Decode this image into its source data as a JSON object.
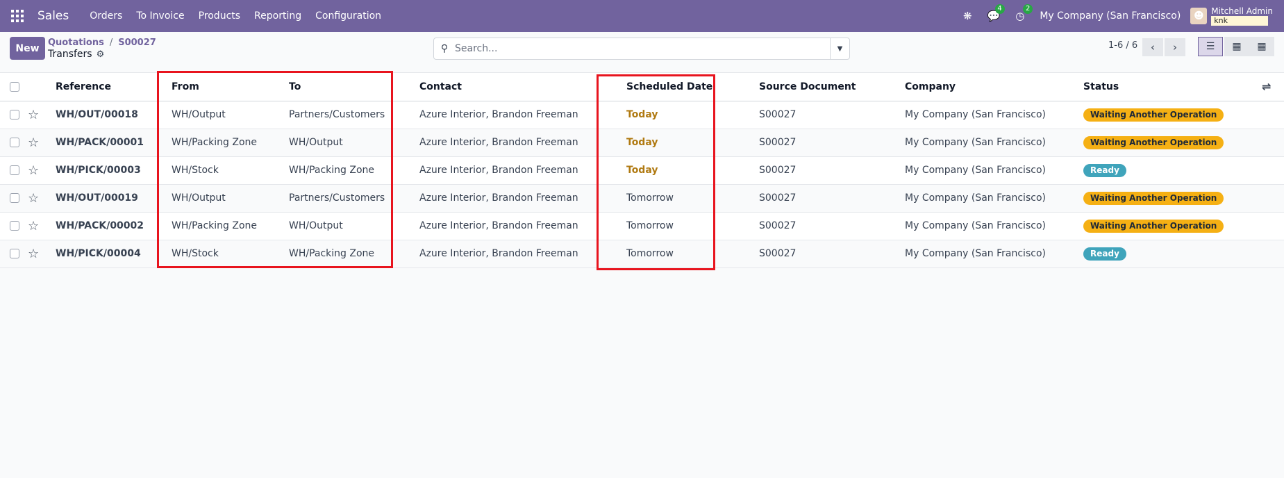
{
  "navbar": {
    "app_name": "Sales",
    "menu": [
      "Orders",
      "To Invoice",
      "Products",
      "Reporting",
      "Configuration"
    ],
    "messages_count": "4",
    "activities_count": "2",
    "company": "My Company (San Francisco)",
    "user_name": "Mitchell Admin",
    "database": "knk"
  },
  "control": {
    "new_label": "New",
    "breadcrumb": [
      "Quotations",
      "S00027"
    ],
    "title": "Transfers",
    "search_placeholder": "Search...",
    "pager": "1-6 / 6"
  },
  "table": {
    "headers": [
      "Reference",
      "From",
      "To",
      "Contact",
      "Scheduled Date",
      "Source Document",
      "Company",
      "Status"
    ],
    "rows": [
      {
        "reference": "WH/OUT/00018",
        "from": "WH/Output",
        "to": "Partners/Customers",
        "contact": "Azure Interior, Brandon Freeman",
        "date": "Today",
        "source": "S00027",
        "company": "My Company (San Francisco)",
        "status": "Waiting Another Operation"
      },
      {
        "reference": "WH/PACK/00001",
        "from": "WH/Packing Zone",
        "to": "WH/Output",
        "contact": "Azure Interior, Brandon Freeman",
        "date": "Today",
        "source": "S00027",
        "company": "My Company (San Francisco)",
        "status": "Waiting Another Operation"
      },
      {
        "reference": "WH/PICK/00003",
        "from": "WH/Stock",
        "to": "WH/Packing Zone",
        "contact": "Azure Interior, Brandon Freeman",
        "date": "Today",
        "source": "S00027",
        "company": "My Company (San Francisco)",
        "status": "Ready"
      },
      {
        "reference": "WH/OUT/00019",
        "from": "WH/Output",
        "to": "Partners/Customers",
        "contact": "Azure Interior, Brandon Freeman",
        "date": "Tomorrow",
        "source": "S00027",
        "company": "My Company (San Francisco)",
        "status": "Waiting Another Operation"
      },
      {
        "reference": "WH/PACK/00002",
        "from": "WH/Packing Zone",
        "to": "WH/Output",
        "contact": "Azure Interior, Brandon Freeman",
        "date": "Tomorrow",
        "source": "S00027",
        "company": "My Company (San Francisco)",
        "status": "Waiting Another Operation"
      },
      {
        "reference": "WH/PICK/00004",
        "from": "WH/Stock",
        "to": "WH/Packing Zone",
        "contact": "Azure Interior, Brandon Freeman",
        "date": "Tomorrow",
        "source": "S00027",
        "company": "My Company (San Francisco)",
        "status": "Ready"
      }
    ]
  },
  "colors": {
    "brand": "#71639e",
    "today": "#b07a12",
    "waiting_badge": "#f5b014",
    "ready_badge": "#3fa4bb",
    "highlight": "#e8141e"
  }
}
